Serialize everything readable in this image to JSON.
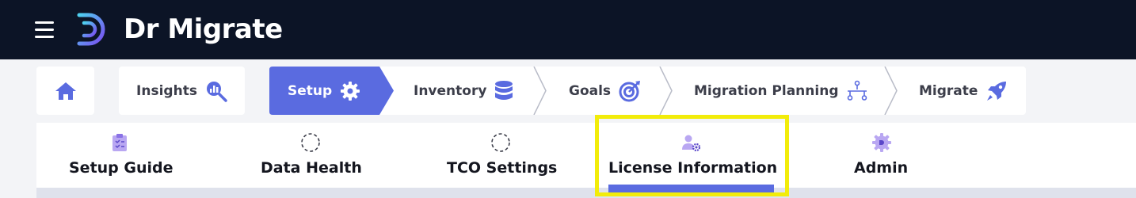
{
  "app": {
    "brand": "Dr Migrate"
  },
  "colors": {
    "topbar": "#0c1426",
    "accent": "#5a6be0",
    "highlight": "#f2ec0a"
  },
  "stepper": {
    "home_icon": "home-icon",
    "steps": [
      {
        "label": "Insights",
        "icon": "insights-search-icon",
        "active": false
      },
      {
        "label": "Setup",
        "icon": "gear-icon",
        "active": true
      },
      {
        "label": "Inventory",
        "icon": "database-icon",
        "active": false
      },
      {
        "label": "Goals",
        "icon": "target-icon",
        "active": false
      },
      {
        "label": "Migration Planning",
        "icon": "hierarchy-icon",
        "active": false
      },
      {
        "label": "Migrate",
        "icon": "rocket-icon",
        "active": false
      }
    ]
  },
  "tabs": [
    {
      "label": "Setup Guide",
      "icon": "clipboard-check-icon",
      "selected": false
    },
    {
      "label": "Data Health",
      "icon": "dashed-circle-icon",
      "selected": false
    },
    {
      "label": "TCO Settings",
      "icon": "dashed-circle-icon",
      "selected": false
    },
    {
      "label": "License Information",
      "icon": "user-gear-icon",
      "selected": true
    },
    {
      "label": "Admin",
      "icon": "admin-gear-icon",
      "selected": false
    }
  ]
}
